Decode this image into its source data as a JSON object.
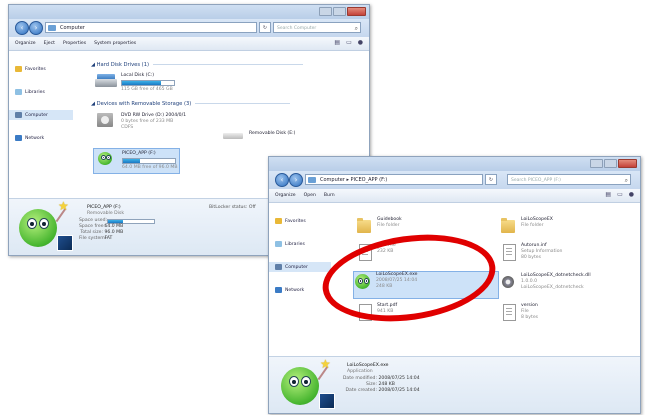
{
  "colors": {
    "highlight_circle": "#e00000",
    "accent": "#1b78c4"
  },
  "window1": {
    "address": "Computer",
    "search_placeholder": "Search Computer",
    "toolbar": [
      "Organize",
      "Eject",
      "Properties",
      "System properties"
    ],
    "nav": [
      "Favorites",
      "Libraries",
      "Computer",
      "Network"
    ],
    "groups": {
      "hard_disk": "Hard Disk Drives (1)",
      "removable": "Devices with Removable Storage (3)"
    },
    "drives": [
      {
        "name": "Local Disk (C:)",
        "sub": "115 GB free of 465 GB",
        "fill": 0.75
      },
      {
        "name": "DVD RW Drive (D:) 2004/0/1",
        "sub1": "0 bytes free of 233 MB",
        "sub2": "CDFS"
      },
      {
        "name": "Removable Disk (E:)"
      },
      {
        "name": "PICEO_APP (F:)",
        "sub": "64.0 MB free of 96.0 MB",
        "fill": 0.33
      }
    ],
    "details": {
      "name": "PICEO_APP (F:)",
      "type": "Removable Disk",
      "bitlocker": "BitLocker status: Off",
      "rows": [
        {
          "k": "Space used:",
          "v": ""
        },
        {
          "k": "Space free:",
          "v": "64.0 MB"
        },
        {
          "k": "Total size:",
          "v": "96.0 MB"
        },
        {
          "k": "File system:",
          "v": "FAT"
        }
      ],
      "used_fill": 0.33
    }
  },
  "window2": {
    "address": "Computer ▸ PICEO_APP (F:)",
    "search_placeholder": "Search PICEO_APP (F:)",
    "toolbar": [
      "Organize",
      "Open",
      "Burn"
    ],
    "nav": [
      "Favorites",
      "Libraries",
      "Computer",
      "Network"
    ],
    "files": [
      {
        "name": "Guidebook",
        "sub1": "File folder",
        "sub2": "",
        "icon": "folder"
      },
      {
        "name": "LoiLoScopeEX",
        "sub1": "File folder",
        "sub2": "",
        "icon": "folder"
      },
      {
        "name": "",
        "sub1": "CAB File",
        "sub2": "232 KB",
        "icon": "doc"
      },
      {
        "name": "Autorun.inf",
        "sub1": "Setup Information",
        "sub2": "80 bytes",
        "icon": "doc"
      },
      {
        "name": "LoiLoScopeEX.exe",
        "sub1": "2008/07/25 14:04",
        "sub2": "248 KB",
        "icon": "app"
      },
      {
        "name": "LoiLoScopeEX_dotnetcheck.dll",
        "sub1": "1.0.0.0",
        "sub2": "LoiLoScopeEX_dotnetcheck",
        "icon": "gear"
      },
      {
        "name": "Start.pdf",
        "sub1": "",
        "sub2": "941 KB",
        "icon": "pdf"
      },
      {
        "name": "version",
        "sub1": "File",
        "sub2": "8 bytes",
        "icon": "doc"
      }
    ],
    "details": {
      "name": "LoiLoScopeEX.exe",
      "type": "Application",
      "rows": [
        {
          "k": "Date modified:",
          "v": "2008/07/25 14:04"
        },
        {
          "k": "Size:",
          "v": "248 KB"
        },
        {
          "k": "Date created:",
          "v": "2008/07/25 14:04"
        }
      ]
    }
  }
}
